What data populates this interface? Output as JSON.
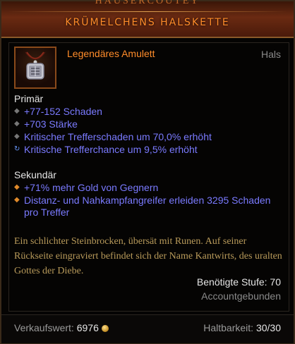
{
  "header": {
    "top_text": "HÄUSERCOUTEY",
    "title": "KRÜMELCHENS HALSKETTE"
  },
  "item": {
    "type": "Legendäres Amulett",
    "slot": "Hals",
    "icon": "amulet-icon"
  },
  "primary": {
    "title": "Primär",
    "stats": [
      "+77-152 Schaden",
      "+703 Stärke",
      "Kritischer Trefferschaden um 70,0% erhöht",
      "Kritische Trefferchance um 9,5% erhöht"
    ]
  },
  "secondary": {
    "title": "Sekundär",
    "stats": [
      "+71% mehr Gold von Gegnern",
      "Distanz- und Nahkampfangreifer erleiden 3295 Schaden pro Treffer"
    ]
  },
  "flavor": "Ein schlichter Steinbrocken, übersät mit Runen. Auf seiner Rückseite eingraviert befindet sich der Name Kantwirts, des uralten Gottes der Diebe.",
  "requirements": {
    "level": "Benötigte Stufe: 70",
    "binding": "Accountgebunden"
  },
  "footer": {
    "sell_label": "Verkaufswert:",
    "sell_value": "6976",
    "durability_label": "Haltbarkeit:",
    "durability_value": "30/30"
  },
  "colors": {
    "legendary": "#ff8c2a",
    "magic": "#7a7aff",
    "flavor": "#b89a5a"
  }
}
